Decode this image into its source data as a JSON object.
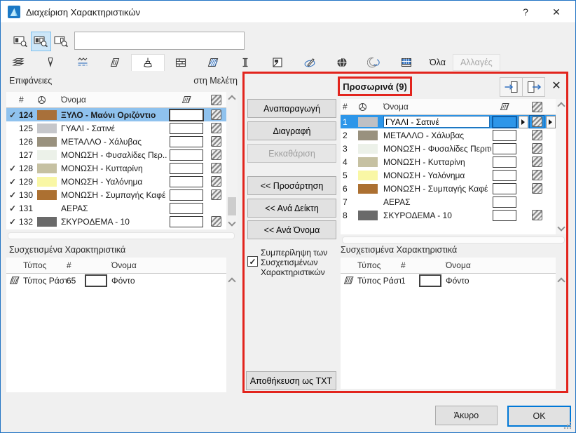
{
  "window": {
    "title": "Διαχείριση Χαρακτηριστικών",
    "help_label": "?",
    "close_label": "✕"
  },
  "search": {
    "value": ""
  },
  "tabs": {
    "icons": [
      "layers",
      "pens",
      "line-types",
      "fill-types",
      "surfaces",
      "composites",
      "building-materials",
      "profiles",
      "zone-categories",
      "markup-styles",
      "cities",
      "operation-profiles",
      "mep-systems"
    ],
    "active": "surfaces",
    "all_label": "Όλα",
    "changes_label": "Αλλαγές"
  },
  "left_panel": {
    "title": "Επιφάνειες",
    "scope_label": "στη Μελέτη",
    "header": {
      "index": "#",
      "name": "Όνομα"
    },
    "rows": [
      {
        "check": "✓",
        "index": "124",
        "swatch": "#A8703A",
        "name": "ΞΥΛΟ - Μαόνι Οριζόντιο"
      },
      {
        "check": "",
        "index": "125",
        "swatch": "#C6C7CB",
        "name": "ΓΥΑΛΙ - Σατινέ"
      },
      {
        "check": "",
        "index": "126",
        "swatch": "#99917E",
        "name": "ΜΕΤΑΛΛΟ - Χάλυβας"
      },
      {
        "check": "",
        "index": "127",
        "swatch": "#ECF1E9",
        "name": "ΜΟΝΩΣΗ - Φυσαλίδες Περ..."
      },
      {
        "check": "✓",
        "index": "128",
        "swatch": "#C6C1A2",
        "name": "ΜΟΝΩΣΗ - Κυτταρίνη"
      },
      {
        "check": "✓",
        "index": "129",
        "swatch": "#F9F7A5",
        "name": "ΜΟΝΩΣΗ - Υαλόνημα"
      },
      {
        "check": "✓",
        "index": "130",
        "swatch": "#AC7031",
        "name": "ΜΟΝΩΣΗ - Συμπαγής Καφέ"
      },
      {
        "check": "✓",
        "index": "131",
        "swatch": "",
        "name": "ΑΕΡΑΣ"
      },
      {
        "check": "✓",
        "index": "132",
        "swatch": "#6A6A6A",
        "name": "ΣΚΥΡΟΔΕΜΑ - 10"
      }
    ]
  },
  "middle": {
    "duplicate": "Αναπαραγωγή",
    "delete": "Διαγραφή",
    "purge": "Εκκαθάριση",
    "append": "<< Προσάρτηση",
    "by_index": "<< Ανά Δείκτη",
    "by_name": "<< Ανά Όνομα",
    "include_checkbox": "Συμπερίληψη των Συσχετισμένων Χαρακτηριστικών",
    "checkbox_glyph": "✓",
    "save_txt": "Αποθήκευση ως TXT"
  },
  "right_panel": {
    "title": "Προσωρινά (9)",
    "header": {
      "index": "#",
      "name": "Όνομα"
    },
    "rows": [
      {
        "index": "1",
        "swatch": "#BFC0C4",
        "name": "ΓΥΑΛΙ - Σατινέ"
      },
      {
        "index": "2",
        "swatch": "#99917E",
        "name": "ΜΕΤΑΛΛΟ - Χάλυβας"
      },
      {
        "index": "3",
        "swatch": "#ECF1E9",
        "name": "ΜΟΝΩΣΗ - Φυσαλίδες Περιτύ..."
      },
      {
        "index": "4",
        "swatch": "#C6C1A2",
        "name": "ΜΟΝΩΣΗ - Κυτταρίνη"
      },
      {
        "index": "5",
        "swatch": "#F9F7A5",
        "name": "ΜΟΝΩΣΗ - Υαλόνημα"
      },
      {
        "index": "6",
        "swatch": "#AC7031",
        "name": "ΜΟΝΩΣΗ - Συμπαγής Καφέ"
      },
      {
        "index": "7",
        "swatch": "",
        "name": "ΑΕΡΑΣ"
      },
      {
        "index": "8",
        "swatch": "#6A6A6A",
        "name": "ΣΚΥΡΟΔΕΜΑ - 10"
      }
    ]
  },
  "associated_left": {
    "title": "Συσχετισμένα Χαρακτηριστικά",
    "header": {
      "type": "Τύπος",
      "index": "#",
      "name": "Όνομα"
    },
    "row": {
      "type": "Τύπος Ράστ",
      "index": "65",
      "name": "Φόντο"
    }
  },
  "associated_right": {
    "title": "Συσχετισμένα Χαρακτηριστικά",
    "header": {
      "type": "Τύπος",
      "index": "#",
      "name": "Όνομα"
    },
    "row": {
      "type": "Τύπος Ράστ",
      "index": "1",
      "name": "Φόντο"
    }
  },
  "footer": {
    "cancel": "Άκυρο",
    "ok": "OK"
  },
  "colors": {
    "accent_blue": "#2D96E9",
    "inactive_selection_blue": "#8FC2EE",
    "annotation_red": "#E2241D",
    "window_border": "#2173C4"
  }
}
